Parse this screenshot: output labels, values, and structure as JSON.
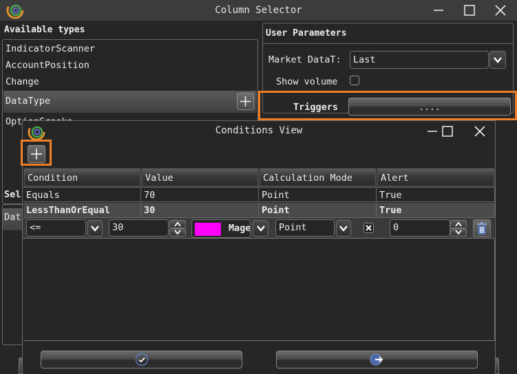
{
  "main_window": {
    "title": "Column Selector",
    "controls": {
      "minimize": "minimize",
      "maximize": "maximize",
      "close": "close"
    },
    "available_types": {
      "header": "Available types",
      "items": [
        {
          "label": "IndicatorScanner",
          "selected": false
        },
        {
          "label": "AccountPosition",
          "selected": false
        },
        {
          "label": "Change",
          "selected": false
        },
        {
          "label": "DataType",
          "selected": true
        },
        {
          "label": "OptionGreeks",
          "selected": false,
          "partially_hidden_text": "Opti"
        }
      ],
      "add_button_icon": "plus-icon"
    },
    "selected_columns": {
      "header_visible": "Sel",
      "item_visible": "Dat"
    },
    "user_parameters": {
      "title": "User Parameters",
      "market_data_type": {
        "label": "Market DataType",
        "label_visible": "Market DataT:",
        "value": "Last"
      },
      "show_volume": {
        "label": "Show volume",
        "checked": false
      },
      "triggers": {
        "label": "Triggers",
        "button_label": "...."
      }
    },
    "highlight_color": "#f07f26"
  },
  "conditions_window": {
    "title": "Conditions View",
    "add_button_icon": "plus-icon",
    "grid": {
      "columns": [
        "Condition",
        "Value",
        "Calculation Mode",
        "Alert"
      ],
      "rows": [
        {
          "condition": "Equals",
          "value": "70",
          "calculation_mode": "Point",
          "alert": "True",
          "selected": false
        },
        {
          "condition": "LessThanOrEqual",
          "value": "30",
          "calculation_mode": "Point",
          "alert": "True",
          "selected": true
        }
      ]
    },
    "editor": {
      "operator": "<=",
      "value": "30",
      "color_name": "Magenta",
      "color_name_visible": "Mage",
      "color_hex": "#ff00ff",
      "calculation_mode": "Point",
      "alert_checked": true,
      "offset": "0"
    },
    "footer": {
      "ok_icon": "checkmark-circle-icon",
      "exit_icon": "exit-arrow-icon"
    }
  }
}
